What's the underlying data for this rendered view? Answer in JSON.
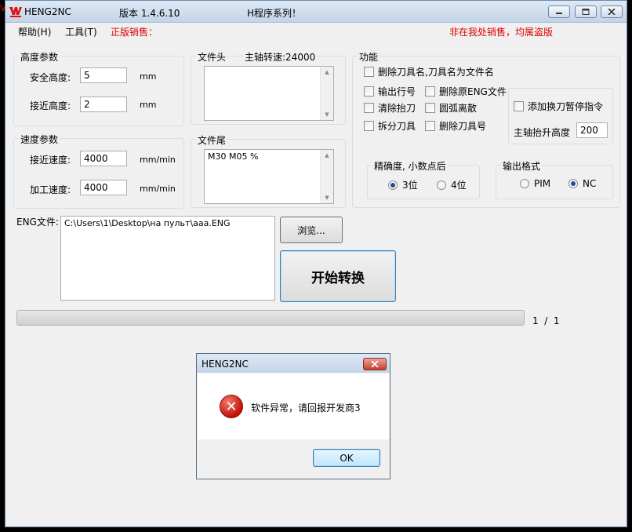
{
  "window": {
    "title": "HENG2NC",
    "version": "版本 1.4.6.10",
    "series": "H程序系列！"
  },
  "menu": {
    "help": "帮助(H)",
    "tools": "工具(T)",
    "genuine": "正版销售：",
    "warning": "非在我处销售，均属盗版"
  },
  "height_params": {
    "title": "高度参数",
    "safe_label": "安全高度:",
    "safe_value": "5",
    "safe_unit": "mm",
    "approach_label": "接近高度:",
    "approach_value": "2",
    "approach_unit": "mm"
  },
  "speed_params": {
    "title": "速度参数",
    "approach_label": "接近速度:",
    "approach_value": "4000",
    "approach_unit": "mm/min",
    "feed_label": "加工速度:",
    "feed_value": "4000",
    "feed_unit": "mm/min"
  },
  "file_header": {
    "title": "文件头",
    "spindle": "主轴转速:24000",
    "content": ""
  },
  "file_tail": {
    "title": "文件尾",
    "content": "M30 M05 %"
  },
  "functions": {
    "title": "功能",
    "tool_name_as_file": "删除刀具名,刀具名为文件名",
    "output_line_no": "输出行号",
    "delete_orig_eng": "删除原ENG文件",
    "clear_lift": "清除抬刀",
    "arc_discrete": "圆弧离散",
    "split_tool": "拆分刀具",
    "delete_tool_no": "删除刀具号",
    "add_tool_pause": "添加换刀暂停指令",
    "spindle_lift_label": "主轴抬升高度",
    "spindle_lift_value": "200"
  },
  "precision": {
    "title": "精确度, 小数点后",
    "opt1": "3位",
    "opt2": "4位",
    "selected": "3位"
  },
  "output_format": {
    "title": "输出格式",
    "opt1": "PIM",
    "opt2": "NC",
    "selected": "NC"
  },
  "eng": {
    "label": "ENG文件:",
    "path": "C:\\Users\\1\\Desktop\\на пульт\\aaa.ENG",
    "browse": "浏览...",
    "start": "开始转换"
  },
  "progress": {
    "text": "1  /  1",
    "value": 0
  },
  "dialog": {
    "title": "HENG2NC",
    "message": "软件异常，请回报开发商3",
    "ok": "OK",
    "icon": "error-icon"
  },
  "colors": {
    "warning_red": "#e00000",
    "title_bar": "#c3d4e8",
    "error_red": "#c3120a"
  }
}
